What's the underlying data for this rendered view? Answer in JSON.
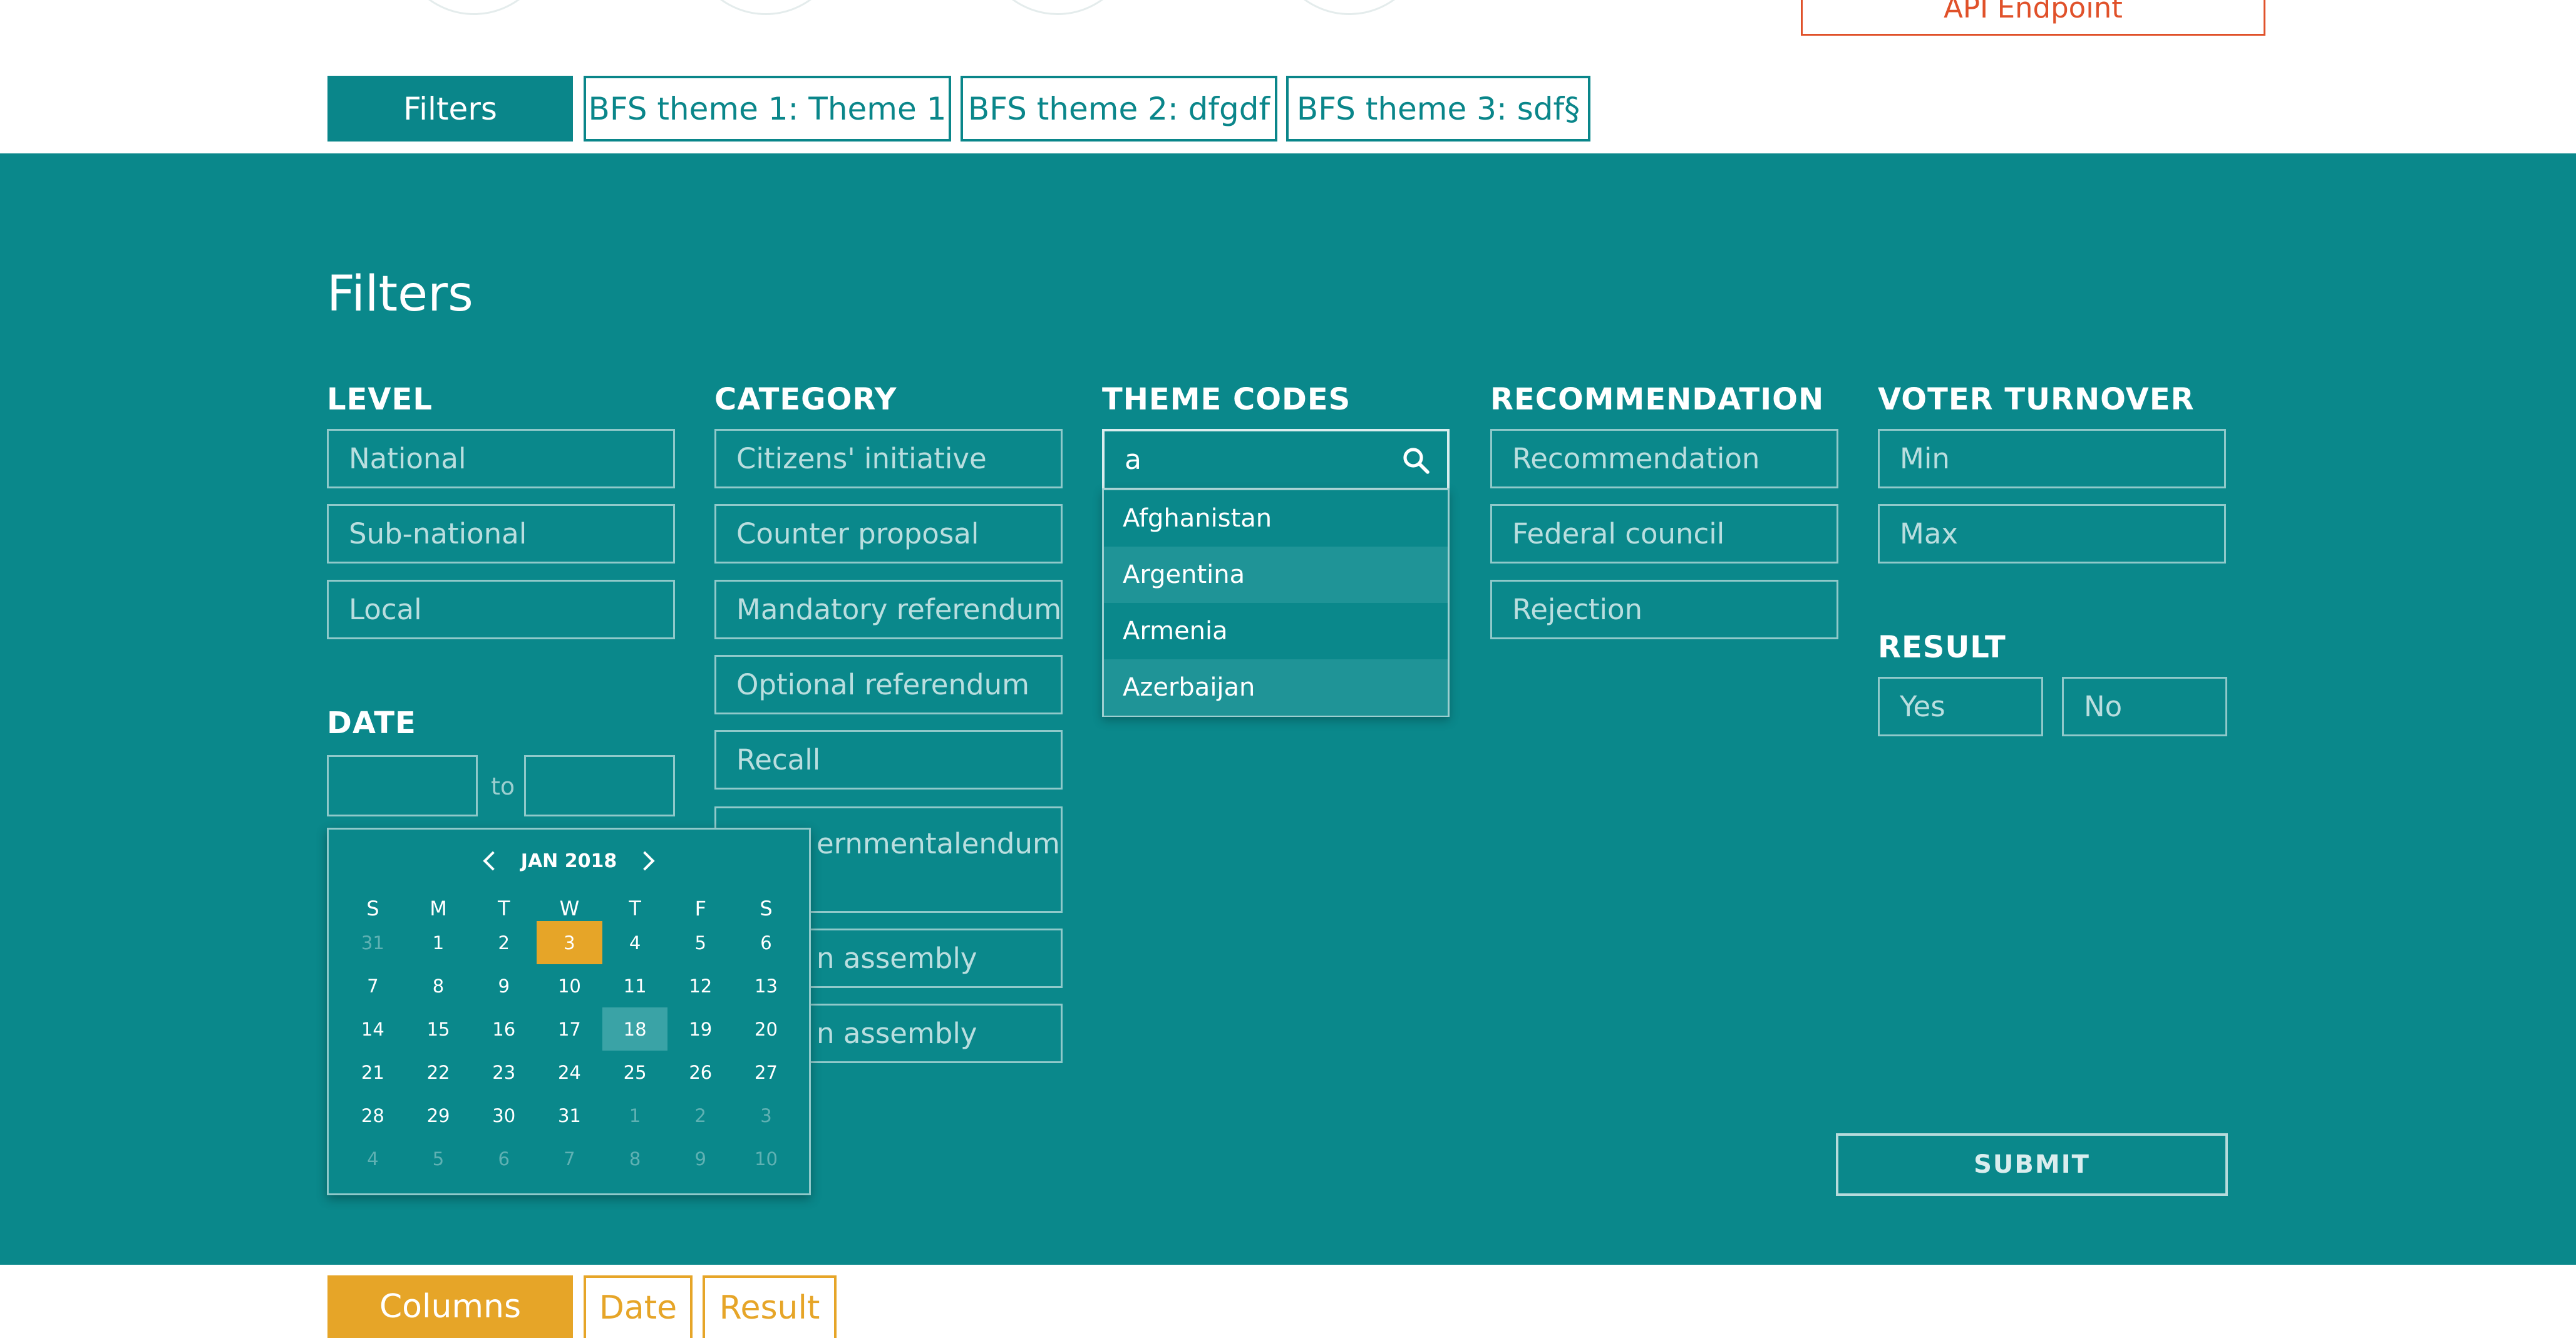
{
  "header": {
    "api_button_label": "API Endpoint"
  },
  "top_tabs": [
    {
      "label": "Filters"
    },
    {
      "label": "BFS theme 1: Theme 1"
    },
    {
      "label": "BFS theme 2: dfgdf"
    },
    {
      "label": "BFS theme 3: sdf§"
    }
  ],
  "panel": {
    "title": "Filters",
    "level": {
      "label": "LEVEL",
      "options": [
        "National",
        "Sub-national",
        "Local"
      ]
    },
    "date": {
      "label": "DATE",
      "from_value": "",
      "to_label": "to",
      "to_value": ""
    },
    "category": {
      "label": "CATEGORY",
      "options": [
        "Citizens' initiative",
        "Counter proposal",
        "Mandatory referendum",
        "Optional referendum",
        "Recall",
        "Governmental referendum",
        "Citizen assembly",
        "Citizen assembly"
      ],
      "partial_options": [
        "ernmental",
        "endum",
        "n assembly",
        "n assembly"
      ]
    },
    "theme_codes": {
      "label": "THEME CODES",
      "search_value": "a",
      "icon": "search-icon",
      "results": [
        "Afghanistan",
        "Argentina",
        "Armenia",
        "Azerbaijan"
      ]
    },
    "recommendation": {
      "label": "RECOMMENDATION",
      "options": [
        "Recommendation",
        "Federal council",
        "Rejection"
      ]
    },
    "voter_turnover": {
      "label": "VOTER TURNOVER",
      "min_placeholder": "Min",
      "max_placeholder": "Max"
    },
    "result": {
      "label": "RESULT",
      "options": [
        "Yes",
        "No"
      ]
    },
    "submit_label": "SUBMIT"
  },
  "calendar": {
    "month_label": "JAN 2018",
    "weekdays": [
      "S",
      "M",
      "T",
      "W",
      "T",
      "F",
      "S"
    ],
    "weeks": [
      [
        "31",
        "1",
        "2",
        "3",
        "4",
        "5",
        "6"
      ],
      [
        "7",
        "8",
        "9",
        "10",
        "11",
        "12",
        "13"
      ],
      [
        "14",
        "15",
        "16",
        "17",
        "18",
        "19",
        "20"
      ],
      [
        "21",
        "22",
        "23",
        "24",
        "25",
        "26",
        "27"
      ],
      [
        "28",
        "29",
        "30",
        "31",
        "1",
        "2",
        "3"
      ],
      [
        "4",
        "5",
        "6",
        "7",
        "8",
        "9",
        "10"
      ]
    ],
    "today": "3",
    "hovered": "18",
    "colors": {
      "today": "#e6a528",
      "hover": "#3aa3a6"
    }
  },
  "bottom_tabs": [
    {
      "label": "Columns"
    },
    {
      "label": "Date"
    },
    {
      "label": "Result"
    }
  ],
  "colors": {
    "teal": "#0a888b",
    "accent_orange": "#e6a528",
    "api_red": "#e0512a"
  }
}
